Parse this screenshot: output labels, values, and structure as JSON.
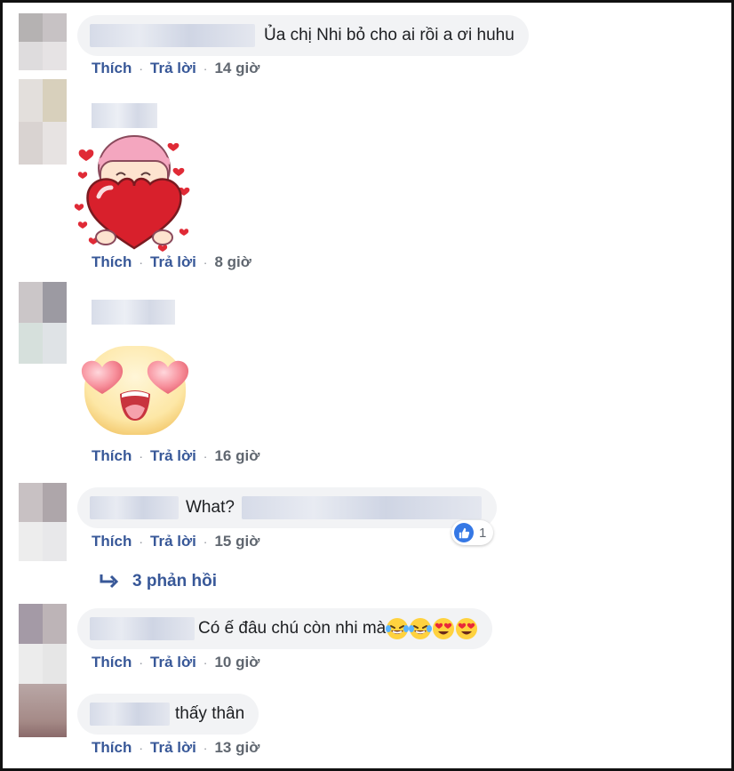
{
  "actions": {
    "like": "Thích",
    "reply": "Trả lời"
  },
  "comments": [
    {
      "text": "Ủa chị Nhi bỏ cho ai rồi a ơi huhu",
      "time": "14 giờ"
    },
    {
      "sticker": "girl-holding-heart-sticker",
      "time": "8 giờ"
    },
    {
      "sticker": "heart-eyes-emoji-sticker",
      "time": "16 giờ"
    },
    {
      "text": "What?",
      "time": "15 giờ",
      "reaction_count": "1",
      "reaction_icon": "like-reaction-icon"
    },
    {
      "text": "Có ế đâu chú còn nhi mà",
      "time": "10 giờ",
      "emojis": [
        "laughing-crying-emoji",
        "laughing-crying-emoji",
        "heart-eyes-emoji",
        "heart-eyes-emoji"
      ]
    },
    {
      "text": "thấy thân",
      "time": "13 giờ"
    }
  ],
  "replies_link": "3 phản hồi",
  "colors": {
    "link": "#385898",
    "bubble": "#f2f3f5",
    "like_blue": "#3578e5",
    "meta": "#606770"
  }
}
